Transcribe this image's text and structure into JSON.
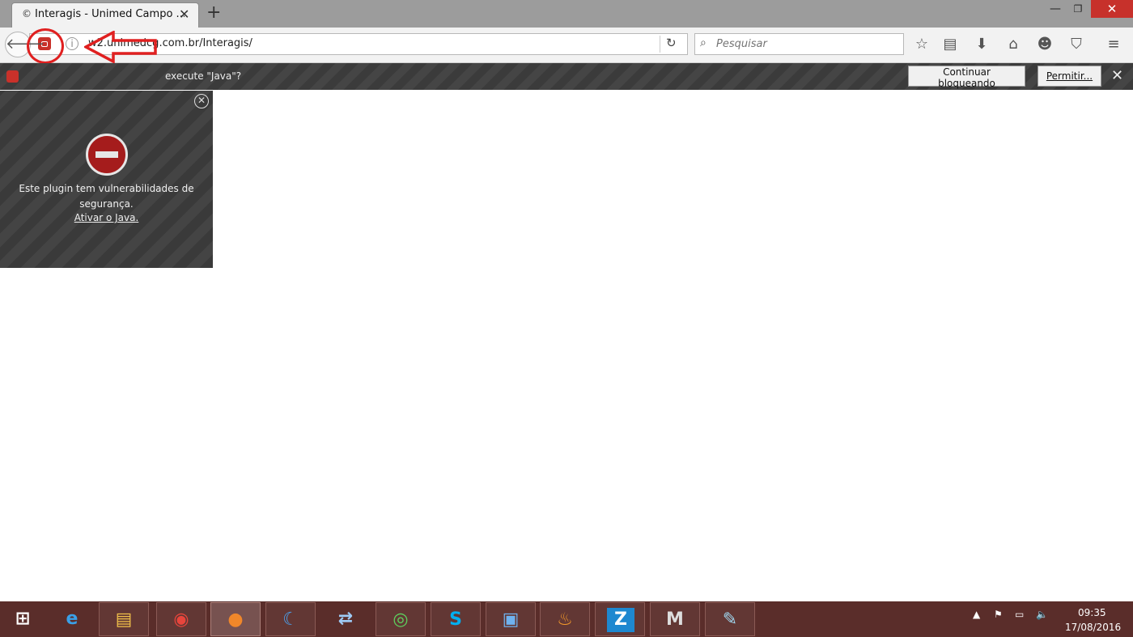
{
  "browser": {
    "tab": {
      "favicon": "©",
      "title": "Interagis - Unimed Campo ..."
    },
    "window": {
      "minimize": "—",
      "maximize": "❐",
      "close": "✕"
    }
  },
  "navbar": {
    "url": "w2.unimedcg.com.br/Interagis/",
    "search_placeholder": "Pesquisar",
    "icons": [
      "bookmark-star-icon",
      "reading-list-icon",
      "download-icon",
      "home-icon",
      "hello-icon",
      "pocket-icon",
      "menu-icon"
    ]
  },
  "notification": {
    "text": "execute \"Java\"?",
    "keep_blocking": "Continuar bloqueando",
    "allow": "Permitir..."
  },
  "plugin_box": {
    "message": "Este plugin tem vulnerabilidades de segurança.",
    "link": "Ativar o Java."
  },
  "taskbar": {
    "apps": [
      {
        "name": "start-button",
        "glyph": "⊞"
      },
      {
        "name": "internet-explorer",
        "glyph": "e"
      },
      {
        "name": "file-explorer",
        "glyph": "▤"
      },
      {
        "name": "chrome",
        "glyph": "◉"
      },
      {
        "name": "firefox",
        "glyph": "●"
      },
      {
        "name": "app-phone",
        "glyph": "☾"
      },
      {
        "name": "network-app",
        "glyph": "⇄"
      },
      {
        "name": "eye-app",
        "glyph": "◎"
      },
      {
        "name": "skype",
        "glyph": "S"
      },
      {
        "name": "remote-desktop",
        "glyph": "▣"
      },
      {
        "name": "flame-app",
        "glyph": "♨"
      },
      {
        "name": "z-app",
        "glyph": "Z"
      },
      {
        "name": "mobile-app",
        "glyph": "M"
      },
      {
        "name": "notes-app",
        "glyph": "✎"
      }
    ],
    "time": "09:35",
    "date": "17/08/2016"
  },
  "colors": {
    "accent": "#c9312a",
    "taskbar": "#5a2d2a",
    "annotation": "#e02020"
  }
}
